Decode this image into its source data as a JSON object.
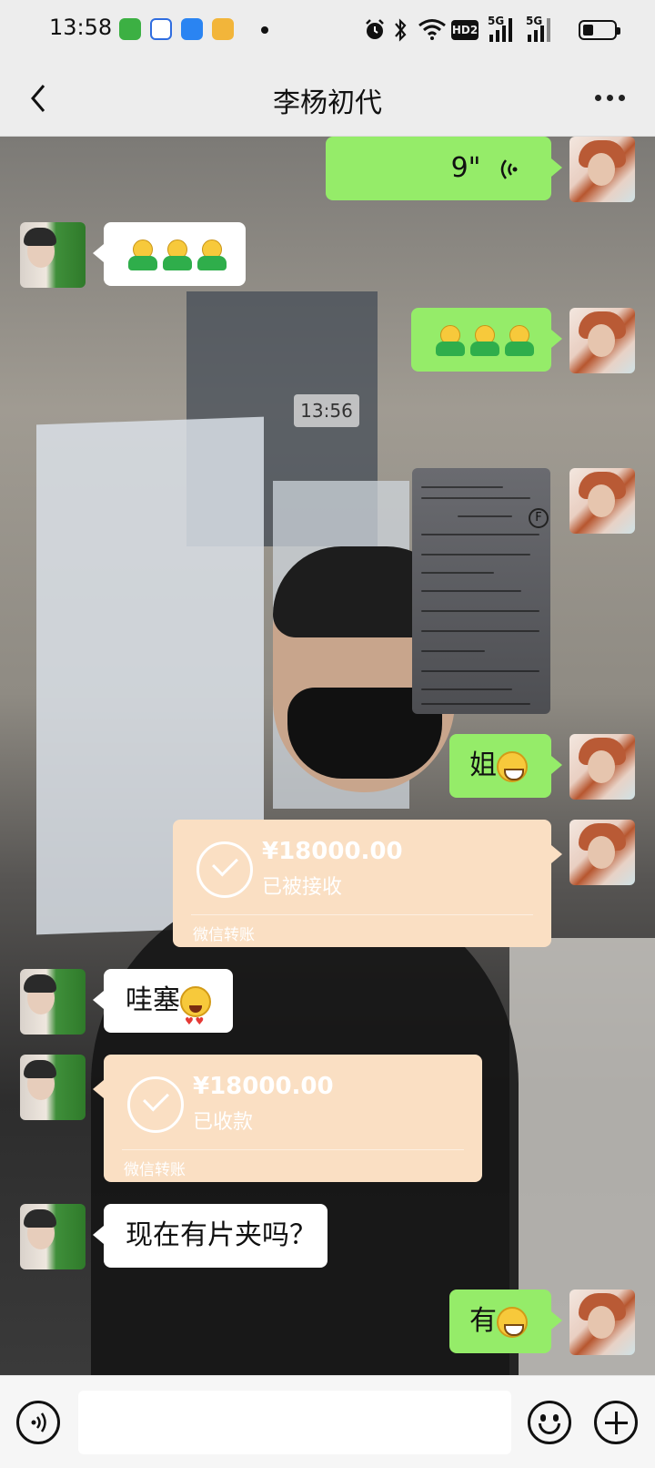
{
  "status_bar": {
    "time": "13:58",
    "apps": [
      "wechat-icon",
      "baidu-icon",
      "browser-icon",
      "weibo-icon"
    ],
    "right_icons": [
      "alarm-icon",
      "bluetooth-icon",
      "wifi-icon",
      "hd-icon",
      "signal-icon",
      "battery-icon"
    ],
    "hd_label": "HD2",
    "signal_label_1": "5G",
    "signal_label_2": "5G"
  },
  "header": {
    "title": "李杨初代"
  },
  "messages": [
    {
      "id": "m1",
      "side": "right",
      "type": "voice",
      "duration": "9\""
    },
    {
      "id": "m2",
      "side": "left",
      "type": "emoji",
      "emojis": [
        "hug-emoji",
        "hug-emoji",
        "hug-emoji"
      ]
    },
    {
      "id": "m3",
      "side": "right",
      "type": "emoji",
      "emojis": [
        "hug-emoji",
        "hug-emoji",
        "hug-emoji"
      ]
    },
    {
      "id": "m4",
      "type": "timestamp",
      "text": "13:56"
    },
    {
      "id": "m5",
      "side": "right",
      "type": "image"
    },
    {
      "id": "m6",
      "side": "right",
      "type": "text",
      "text": "姐",
      "emoji": "grin-emoji"
    },
    {
      "id": "m7",
      "side": "right",
      "type": "transfer",
      "amount": "¥18000.00",
      "status": "已被接收",
      "footer": "微信转账"
    },
    {
      "id": "m8",
      "side": "left",
      "type": "text",
      "text": "哇塞",
      "emoji": "heart-eyes-emoji"
    },
    {
      "id": "m9",
      "side": "left",
      "type": "transfer",
      "amount": "¥18000.00",
      "status": "已收款",
      "footer": "微信转账"
    },
    {
      "id": "m10",
      "side": "left",
      "type": "text",
      "text": "现在有片夹吗？"
    },
    {
      "id": "m11",
      "side": "right",
      "type": "text",
      "text": "有",
      "emoji": "grin-emoji"
    }
  ],
  "photo_letter": "F",
  "input_bar": {
    "value": ""
  },
  "colors": {
    "bubble_green": "#95ec69",
    "bubble_white": "#ffffff",
    "transfer_bg": "#fadfc3",
    "header_bg": "#ededed"
  }
}
